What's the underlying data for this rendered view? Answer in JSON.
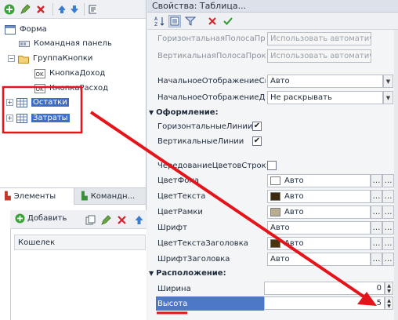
{
  "left_panel": {
    "tree": [
      {
        "label": "Форма",
        "icon": "form-icon"
      },
      {
        "label": "Командная панель",
        "icon": "command-panel-icon"
      },
      {
        "label": "ГруппаКнопки",
        "icon": "folder-icon"
      },
      {
        "label": "КнопкаДоход",
        "icon": "button-ok-icon",
        "badge": "OK"
      },
      {
        "label": "КнопкаРасход",
        "icon": "button-ok-icon",
        "badge": "OK"
      },
      {
        "label": "Остатки",
        "icon": "table-icon"
      },
      {
        "label": "Затраты",
        "icon": "table-icon"
      }
    ],
    "tabs": {
      "elements": "Элементы",
      "commands": "Командн..."
    },
    "add_button": "Добавить",
    "column_header": "Кошелек"
  },
  "properties": {
    "title": "Свойства: Таблица...",
    "rows": {
      "hscroll": {
        "label": "ГоризонтальнаяПолосаПрокрутки",
        "value": "Использовать автоматически"
      },
      "vscroll": {
        "label": "ВертикальнаяПолосаПрокрутки",
        "value": "Использовать автоматически"
      },
      "initial_display": {
        "label": "НачальноеОтображениеСписка",
        "value": "Авто"
      },
      "initial_tree": {
        "label": "НачальноеОтображениеДерева",
        "value": "Не раскрывать"
      },
      "section_appearance": "Оформление:",
      "hlines": {
        "label": "ГоризонтальныеЛинии",
        "checked": "✔"
      },
      "vlines": {
        "label": "ВертикальныеЛинии",
        "checked": "✔"
      },
      "alternate_rows": {
        "label": "ЧередованиеЦветовСтрок",
        "checked": ""
      },
      "bg_color": {
        "label": "ЦветФона",
        "value": "Авто",
        "swatch": "#ffffff"
      },
      "text_color": {
        "label": "ЦветТекста",
        "value": "Авто",
        "swatch": "#3a2a10"
      },
      "border_color": {
        "label": "ЦветРамки",
        "value": "Авто",
        "swatch": "#b9ad92"
      },
      "font": {
        "label": "Шрифт",
        "value": "Авто"
      },
      "header_text_color": {
        "label": "ЦветТекстаЗаголовка",
        "value": "Авто",
        "swatch": "#4a3410"
      },
      "header_font": {
        "label": "ШрифтЗаголовка",
        "value": "Авто"
      },
      "section_layout": "Расположение:",
      "width": {
        "label": "Ширина",
        "value": "0"
      },
      "height": {
        "label": "Высота",
        "value": "5"
      }
    }
  },
  "colors": {
    "selection": "#3f6ec6",
    "annotation_red": "#e4141a"
  }
}
